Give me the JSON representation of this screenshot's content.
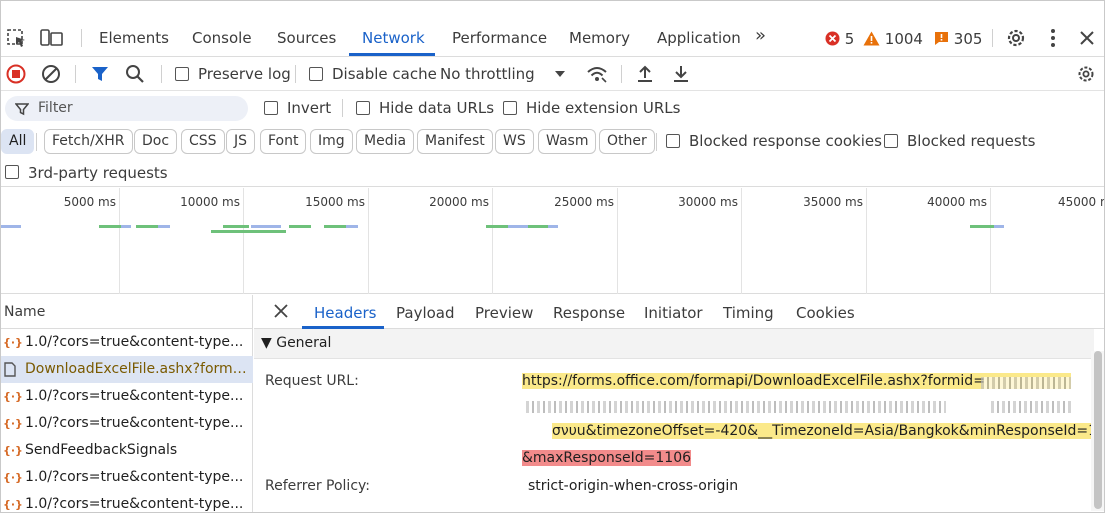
{
  "main_tabs": [
    {
      "label": "Elements"
    },
    {
      "label": "Console"
    },
    {
      "label": "Sources"
    },
    {
      "label": "Network"
    },
    {
      "label": "Performance"
    },
    {
      "label": "Memory"
    },
    {
      "label": "Application"
    }
  ],
  "more_tabs": "»",
  "counters": {
    "errors": "5",
    "warnings": "1004",
    "issues": "305"
  },
  "toolbar": {
    "preserve_log": "Preserve log",
    "disable_cache": "Disable cache",
    "throttling": "No throttling"
  },
  "filter": {
    "placeholder": "Filter",
    "invert": "Invert",
    "hide_data_urls": "Hide data URLs",
    "hide_extension_urls": "Hide extension URLs"
  },
  "type_chips": [
    "All",
    "Fetch/XHR",
    "Doc",
    "CSS",
    "JS",
    "Font",
    "Img",
    "Media",
    "Manifest",
    "WS",
    "Wasm",
    "Other"
  ],
  "blocked_response_cookies": "Blocked response cookies",
  "blocked_requests": "Blocked requests",
  "third_party": "3rd-party requests",
  "overview_ticks": [
    "5000 ms",
    "10000 ms",
    "15000 ms",
    "20000 ms",
    "25000 ms",
    "30000 ms",
    "35000 ms",
    "40000 ms",
    "45000 m"
  ],
  "name_column": {
    "header": "Name",
    "rows": [
      "1.0/?cors=true&content-type...",
      "DownloadExcelFile.ashx?formi...",
      "1.0/?cors=true&content-type...",
      "1.0/?cors=true&content-type...",
      "SendFeedbackSignals",
      "1.0/?cors=true&content-type...",
      "1.0/?cors=true&content-type..."
    ]
  },
  "detail_tabs": [
    "Headers",
    "Payload",
    "Preview",
    "Response",
    "Initiator",
    "Timing",
    "Cookies"
  ],
  "general": {
    "title": "▼ General",
    "request_url_label": "Request URL:",
    "request_url_line1": "https://forms.office.com/formapi/DownloadExcelFile.ashx?formid=",
    "request_url_line3": "u&timezoneOffset=-420&__TimezoneId=Asia/Bangkok&minResponseId=1",
    "request_url_line3_prefix": "σνυ",
    "request_url_line4": "&maxResponseId=1106",
    "referrer_label": "Referrer Policy:",
    "referrer_value": "strict-origin-when-cross-origin"
  },
  "colors": {
    "accent": "#1a62c9",
    "error": "#d93025",
    "warning": "#e8710a",
    "issue": "#e8710a",
    "highlight_yellow": "#fbe98a",
    "highlight_red": "#f28b8b"
  }
}
